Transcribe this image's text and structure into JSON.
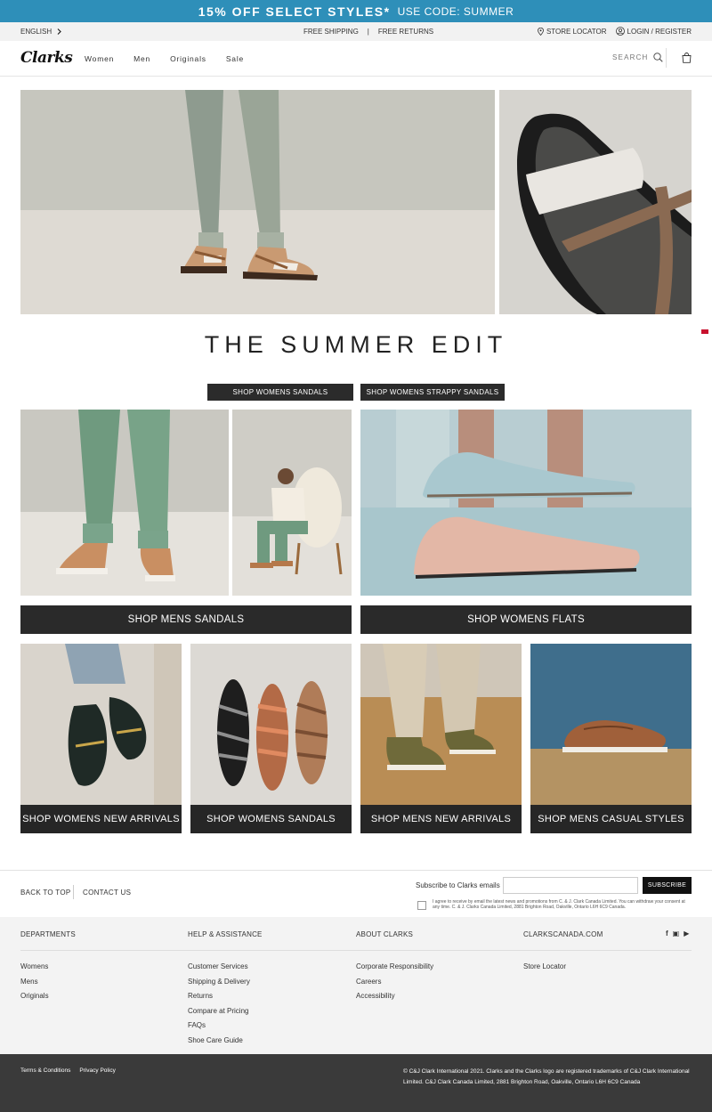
{
  "promo": {
    "headline": "15% OFF SELECT STYLES*",
    "code": "USE CODE: SUMMER"
  },
  "utility": {
    "language": "ENGLISH",
    "free_shipping": "FREE SHIPPING",
    "divider": "|",
    "free_returns": "FREE RETURNS",
    "store_locator": "STORE LOCATOR",
    "login": "LOGIN / REGISTER"
  },
  "nav": {
    "logo": "Clarks",
    "menu": [
      "Women",
      "Men",
      "Originals",
      "Sale"
    ],
    "search_label": "SEARCH"
  },
  "hero": {
    "title": "THE SUMMER EDIT"
  },
  "buttons": {
    "shop_womens_sandals": "SHOP WOMENS SANDALS",
    "shop_womens_strappy": "SHOP WOMENS STRAPPY SANDALS",
    "shop_mens_sandals": "SHOP MENS SANDALS",
    "shop_womens_flats": "SHOP WOMENS FLATS"
  },
  "tiles": [
    {
      "label": "SHOP WOMENS NEW ARRIVALS"
    },
    {
      "label": "SHOP WOMENS SANDALS"
    },
    {
      "label": "SHOP MENS NEW ARRIVALS"
    },
    {
      "label": "SHOP MENS CASUAL STYLES"
    }
  ],
  "footer_top": {
    "back_to_top": "BACK TO TOP",
    "contact_us": "CONTACT US",
    "subscribe_label": "Subscribe to Clarks emails",
    "subscribe_button": "SUBSCRIBE",
    "consent": "I agree to receive by email the latest news and promotions from C. & J. Clark Canada Limited. You can withdraw your consent at any time. C. & J. Clarks Canada Limited, 2881 Brighton Road, Oakville, Ontario L6H 6C9 Canada."
  },
  "footer_columns": {
    "departments": {
      "heading": "DEPARTMENTS",
      "items": [
        "Womens",
        "Mens",
        "Originals"
      ]
    },
    "help": {
      "heading": "HELP & ASSISTANCE",
      "items": [
        "Customer Services",
        "Shipping & Delivery",
        "Returns",
        "Compare at Pricing",
        "FAQs",
        "Shoe Care Guide"
      ]
    },
    "about": {
      "heading": "ABOUT CLARKS",
      "items": [
        "Corporate Responsibility",
        "Careers",
        "Accessibility"
      ]
    },
    "site": {
      "heading": "CLARKSCANADA.COM",
      "items": [
        "Store Locator"
      ]
    }
  },
  "social": [
    "f",
    "▣",
    "▶"
  ],
  "footer_bottom": {
    "terms": "Terms & Conditions",
    "privacy": "Privacy Policy",
    "copyright": "© C&J Clark International 2021. Clarks and the Clarks logo are registered trademarks of C&J Clark International Limited. C&J Clark Canada Limited, 2881 Brighton Road, Oakville, Ontario L6H 6C9 Canada"
  },
  "colors": {
    "promo_bg": "#2e8fb9",
    "dark_button": "#2a2a2a",
    "footer_bottom": "#3a3a3a"
  }
}
